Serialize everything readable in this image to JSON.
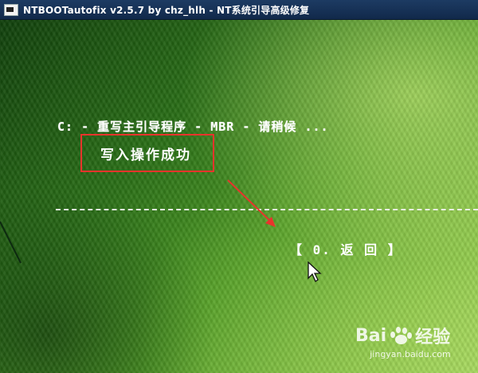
{
  "window": {
    "title": "NTBOOTautofix v2.5.7 by chz_hlh - NT系统引导高级修复"
  },
  "console": {
    "status_line": "C: - 重写主引导程序 - MBR - 请稍候 ...",
    "result": "写入操作成功",
    "return_option": "【 0. 返 回 】"
  },
  "watermark": {
    "brand_left": "Bai",
    "brand_right": "经验",
    "url": "jingyan.baidu.com"
  },
  "colors": {
    "highlight_box": "#e8342c",
    "annotation_arrow": "#e8342c",
    "text": "#ffffff"
  }
}
